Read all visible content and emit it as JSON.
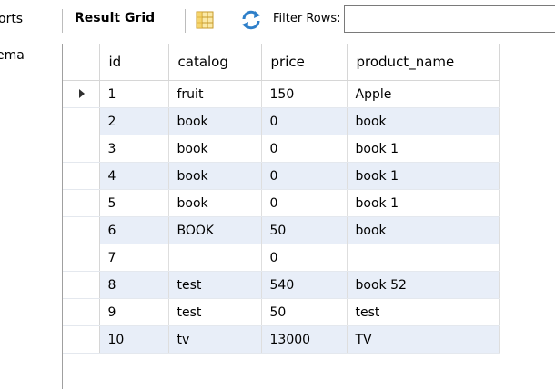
{
  "left_panel": {
    "tab1": "orts",
    "tab2": "ema"
  },
  "toolbar": {
    "result_grid_label": "Result Grid",
    "filter_label": "Filter Rows:",
    "filter_value": ""
  },
  "grid": {
    "columns": [
      "id",
      "catalog",
      "price",
      "product_name"
    ],
    "rows": [
      [
        "1",
        "fruit",
        "150",
        "Apple"
      ],
      [
        "2",
        "book",
        "0",
        "book"
      ],
      [
        "3",
        "book",
        "0",
        "book 1"
      ],
      [
        "4",
        "book",
        "0",
        "book 1"
      ],
      [
        "5",
        "book",
        "0",
        "book 1"
      ],
      [
        "6",
        "BOOK",
        "50",
        "book"
      ],
      [
        "7",
        "",
        "0",
        ""
      ],
      [
        "8",
        "test",
        "540",
        "book 52"
      ],
      [
        "9",
        "test",
        "50",
        "test"
      ],
      [
        "10",
        "tv",
        "13000",
        "TV"
      ]
    ],
    "selected_row_index": 0,
    "alt_row_color": "#e8eef8"
  },
  "icons": {
    "grid_view": "grid-view-icon",
    "refresh": "refresh-icon",
    "row_pointer": "row-pointer-icon"
  }
}
